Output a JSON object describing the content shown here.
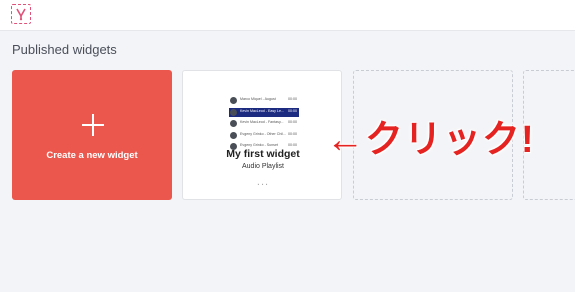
{
  "section_title": "Published widgets",
  "create_card": {
    "label": "Create a new widget"
  },
  "widget_card": {
    "title": "My first widget",
    "subtitle": "Audio Playlist",
    "more": "...",
    "thumbnail_rows": [
      {
        "name": "Marco Miquel - August",
        "time": "00:00",
        "active": false
      },
      {
        "name": "Kevin MacLeod - Easy Le...",
        "time": "00:00",
        "active": true
      },
      {
        "name": "Kevin MacLeod - Fantasy...",
        "time": "00:00",
        "active": false
      },
      {
        "name": "Evgeny Grinko - Other Chil...",
        "time": "00:00",
        "active": false
      },
      {
        "name": "Evgeny Grinko - Sunset",
        "time": "00:00",
        "active": false
      }
    ]
  },
  "annotation": "←クリック!",
  "colors": {
    "accent": "#ec574d",
    "annotation": "#e52421",
    "active_row": "#1c2a80"
  },
  "icons": {
    "logo": "app-logo-icon",
    "plus": "plus-icon"
  }
}
